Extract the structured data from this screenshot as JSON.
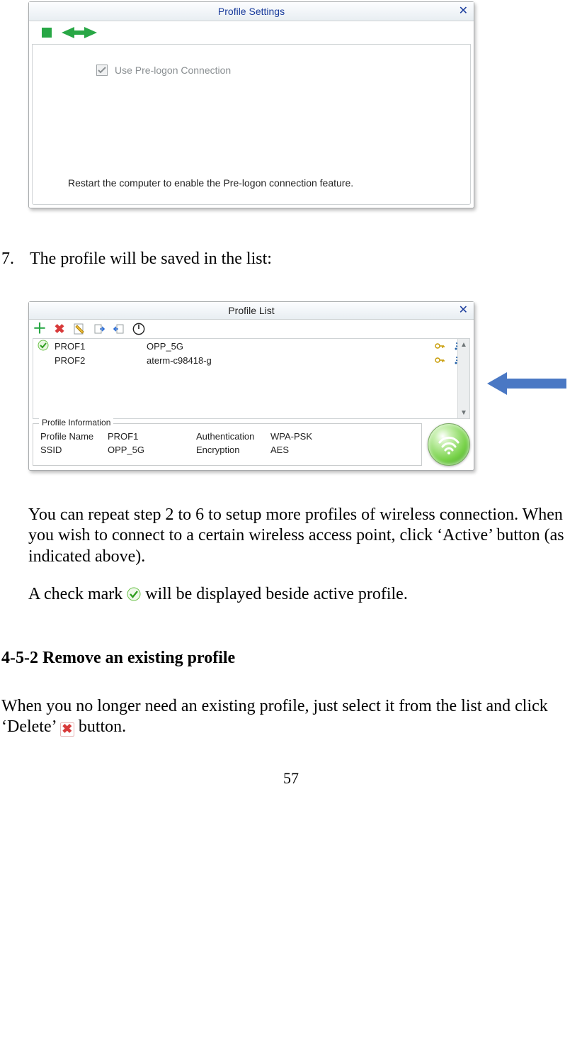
{
  "win1": {
    "title": "Profile Settings",
    "checkbox_label": "Use Pre-logon Connection",
    "restart_msg": "Restart the computer to enable the Pre-logon connection feature."
  },
  "step7": {
    "num": "7.",
    "text": "The profile will be saved in the list:"
  },
  "win2": {
    "title": "Profile List",
    "rows": [
      {
        "name": "PROF1",
        "ssid": "OPP_5G",
        "active": true
      },
      {
        "name": "PROF2",
        "ssid": "aterm-c98418-g",
        "active": false
      }
    ],
    "info": {
      "legend": "Profile Information",
      "labels": {
        "pn": "Profile Name",
        "ssid": "SSID",
        "auth": "Authentication",
        "enc": "Encryption"
      },
      "values": {
        "pn": "PROF1",
        "ssid": "OPP_5G",
        "auth": "WPA-PSK",
        "enc": "AES"
      }
    }
  },
  "body": {
    "p1": "You can repeat step 2 to 6 to setup more profiles of wireless connection. When you wish to connect to a certain wireless access point, click ‘Active’ button (as indicated above).",
    "p2a": "A check mark ",
    "p2b": " will be displayed beside active profile."
  },
  "section": {
    "heading": "4-5-2 Remove an existing profile",
    "p_a": "When you no longer need an existing profile, just select it from the list and click ‘Delete’ ",
    "p_b": " button."
  },
  "page_number": "57"
}
